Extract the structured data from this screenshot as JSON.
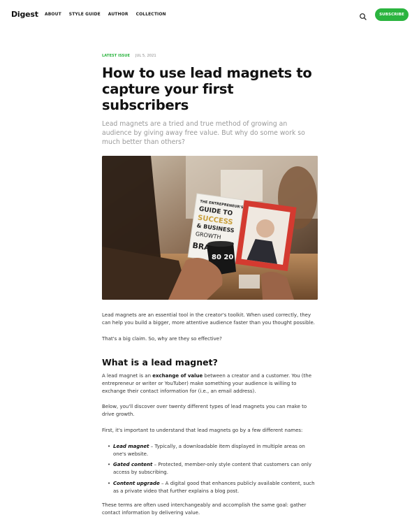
{
  "header": {
    "brand": "Digest",
    "nav": [
      "ABOUT",
      "STYLE GUIDE",
      "AUTHOR",
      "COLLECTION"
    ],
    "search_icon": "search-icon",
    "subscribe_label": "SUBSCRIBE"
  },
  "article": {
    "tag": "LATEST ISSUE",
    "date": "JUL 5, 2021",
    "title": "How to use lead magnets to capture your first subscribers",
    "subtitle": "Lead magnets are a tried and true method of growing an audience by giving away free value. But why do some work so much better than others?",
    "hero_book_text": {
      "line1": "THE ENTREPRENEUR'S",
      "line2": "GUIDE TO",
      "line3": "SUCCESS",
      "line4": "& BUSINESS",
      "line5": "GROWTH",
      "brand": "BRA",
      "mug": "80 20"
    },
    "intro_p1": "Lead magnets are an essential tool in the creator's toolkit. When used correctly, they can help you build a bigger, more attentive audience faster than you thought possible.",
    "intro_p2": "That's a big claim. So, why are they so effective?",
    "h2": "What is a lead magnet?",
    "def_pre": "A lead magnet is an ",
    "def_strong": "exchange of value",
    "def_post": " between a creator and a customer. You (the entrepreneur or writer or YouTuber) make something your audience is willing to exchange their contact information for (i.e., an email address).",
    "p_types": "Below, you'll discover over twenty different types of lead magnets you can make to drive growth.",
    "p_names": "First, it's important to understand that lead magnets go by a few different names:",
    "list": [
      {
        "term": "Lead magnet",
        "desc": " – Typically, a downloadable item displayed in multiple areas on one's website."
      },
      {
        "term": "Gated content",
        "desc": " – Protected, member-only style content that customers can only access by subscribing."
      },
      {
        "term": "Content upgrade",
        "desc": " – A digital good that enhances publicly available content, such as a private video that further explains a blog post."
      }
    ],
    "p_final": "These terms are often used interchangeably and accomplish the same goal: gather contact information by delivering value."
  },
  "colors": {
    "accent": "#2bb43f",
    "text": "#222222",
    "muted": "#999999"
  }
}
